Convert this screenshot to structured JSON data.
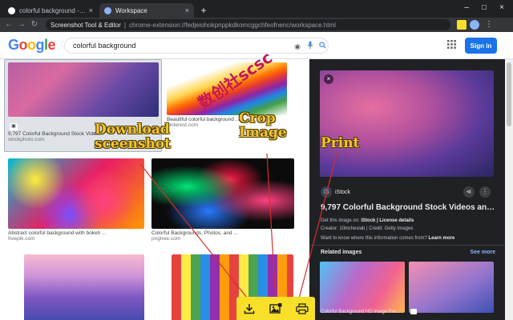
{
  "browser": {
    "tabs": [
      {
        "title": "colorful background - Google Se",
        "active": false,
        "close": "×"
      },
      {
        "title": "Workspace",
        "active": true,
        "close": "×"
      }
    ],
    "new_tab": "+",
    "window_controls": [
      "–",
      "□",
      "×"
    ],
    "nav": {
      "back": "←",
      "forward": "→",
      "reload": "↻"
    },
    "omnibox": {
      "site_label": "Screenshot Tool & Editor",
      "separator": "|",
      "url": "chrome-extension://fedjeiohokpnppkdkomcggchfeofnenc/workspace.html"
    },
    "extension_colors": [
      "#f9e028",
      "#8ab4f8",
      "#9aa0a6"
    ]
  },
  "google": {
    "logo": [
      "G",
      "o",
      "o",
      "g",
      "l",
      "e"
    ],
    "search_value": "colorful background",
    "icons": {
      "camera": "◉",
      "mic": "🎤",
      "search": "🔍"
    },
    "apps_icon": "⋮⋮",
    "signin_label": "Sign in"
  },
  "results": [
    {
      "caption": "9,797 Colorful Background Stock Video...",
      "source": "stockphoto.com",
      "badge": "▣"
    },
    {
      "caption": "Beautiful colorful background ...",
      "source": "pinterest.com"
    },
    {
      "caption": "Abstract colorful background with bokeh ...",
      "source": "freepik.com"
    },
    {
      "caption": "Colorful Backgrounds, Photos, and ...",
      "source": "pngtree.com"
    },
    {
      "caption": "",
      "source": ""
    },
    {
      "caption": "",
      "source": ""
    }
  ],
  "panel": {
    "close": "×",
    "source_badge": "iS",
    "source_name": "iStock",
    "share_icon": "⋖",
    "more_icon": "⋮",
    "title": "9,797 Colorful Background Stock Videos and R...",
    "get_image": "Get this image on: ",
    "get_image_link": "iStock | License details",
    "creator": "Creator: 10incheslab | Credit: Getty Images",
    "want_know": "Want to know where this information comes from? ",
    "learn_more": "Learn more",
    "related_heading": "Related images",
    "see_more": "See more",
    "related": [
      {
        "caption": "Colorful Background HD Image Fre..."
      },
      {
        "caption": ""
      }
    ]
  },
  "overlay": {
    "watermark": "数创社scsc",
    "callouts": {
      "download": "Download sceenshot",
      "crop": "Crop Image",
      "print": "Print"
    },
    "toolbar": {
      "download_icon": "download-icon",
      "crop_icon": "crop-image-icon",
      "print_icon": "printer-icon"
    },
    "accent": "#f9e028",
    "arrow_color": "#d32f2f"
  }
}
